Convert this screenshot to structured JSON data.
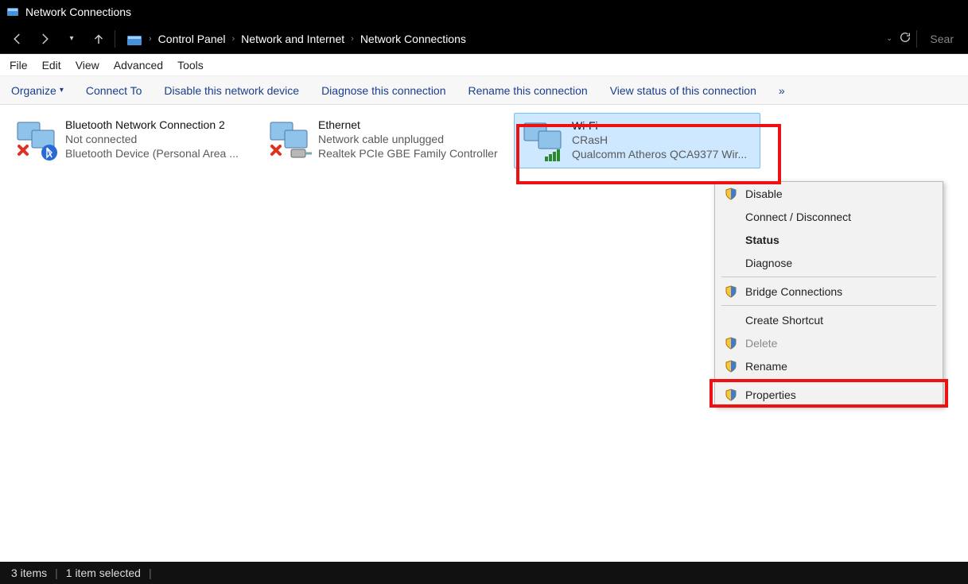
{
  "window": {
    "title": "Network Connections"
  },
  "breadcrumb": {
    "items": [
      "Control Panel",
      "Network and Internet",
      "Network Connections"
    ]
  },
  "search": {
    "placeholder": "Sear"
  },
  "menubar": {
    "items": [
      "File",
      "Edit",
      "View",
      "Advanced",
      "Tools"
    ]
  },
  "toolbar": {
    "organize": "Organize",
    "connect": "Connect To",
    "disable": "Disable this network device",
    "diagnose": "Diagnose this connection",
    "rename": "Rename this connection",
    "viewstatus": "View status of this connection",
    "overflow": "»"
  },
  "connections": [
    {
      "name": "Bluetooth Network Connection 2",
      "status": "Not connected",
      "device": "Bluetooth Device (Personal Area ..."
    },
    {
      "name": "Ethernet",
      "status": "Network cable unplugged",
      "device": "Realtek PCIe GBE Family Controller"
    },
    {
      "name": "Wi-Fi",
      "status": "CRasH",
      "device": "Qualcomm Atheros QCA9377 Wir..."
    }
  ],
  "contextmenu": {
    "disable": "Disable",
    "connect": "Connect / Disconnect",
    "status": "Status",
    "diagnose": "Diagnose",
    "bridge": "Bridge Connections",
    "shortcut": "Create Shortcut",
    "delete": "Delete",
    "rename": "Rename",
    "properties": "Properties"
  },
  "statusbar": {
    "count": "3 items",
    "selected": "1 item selected"
  }
}
